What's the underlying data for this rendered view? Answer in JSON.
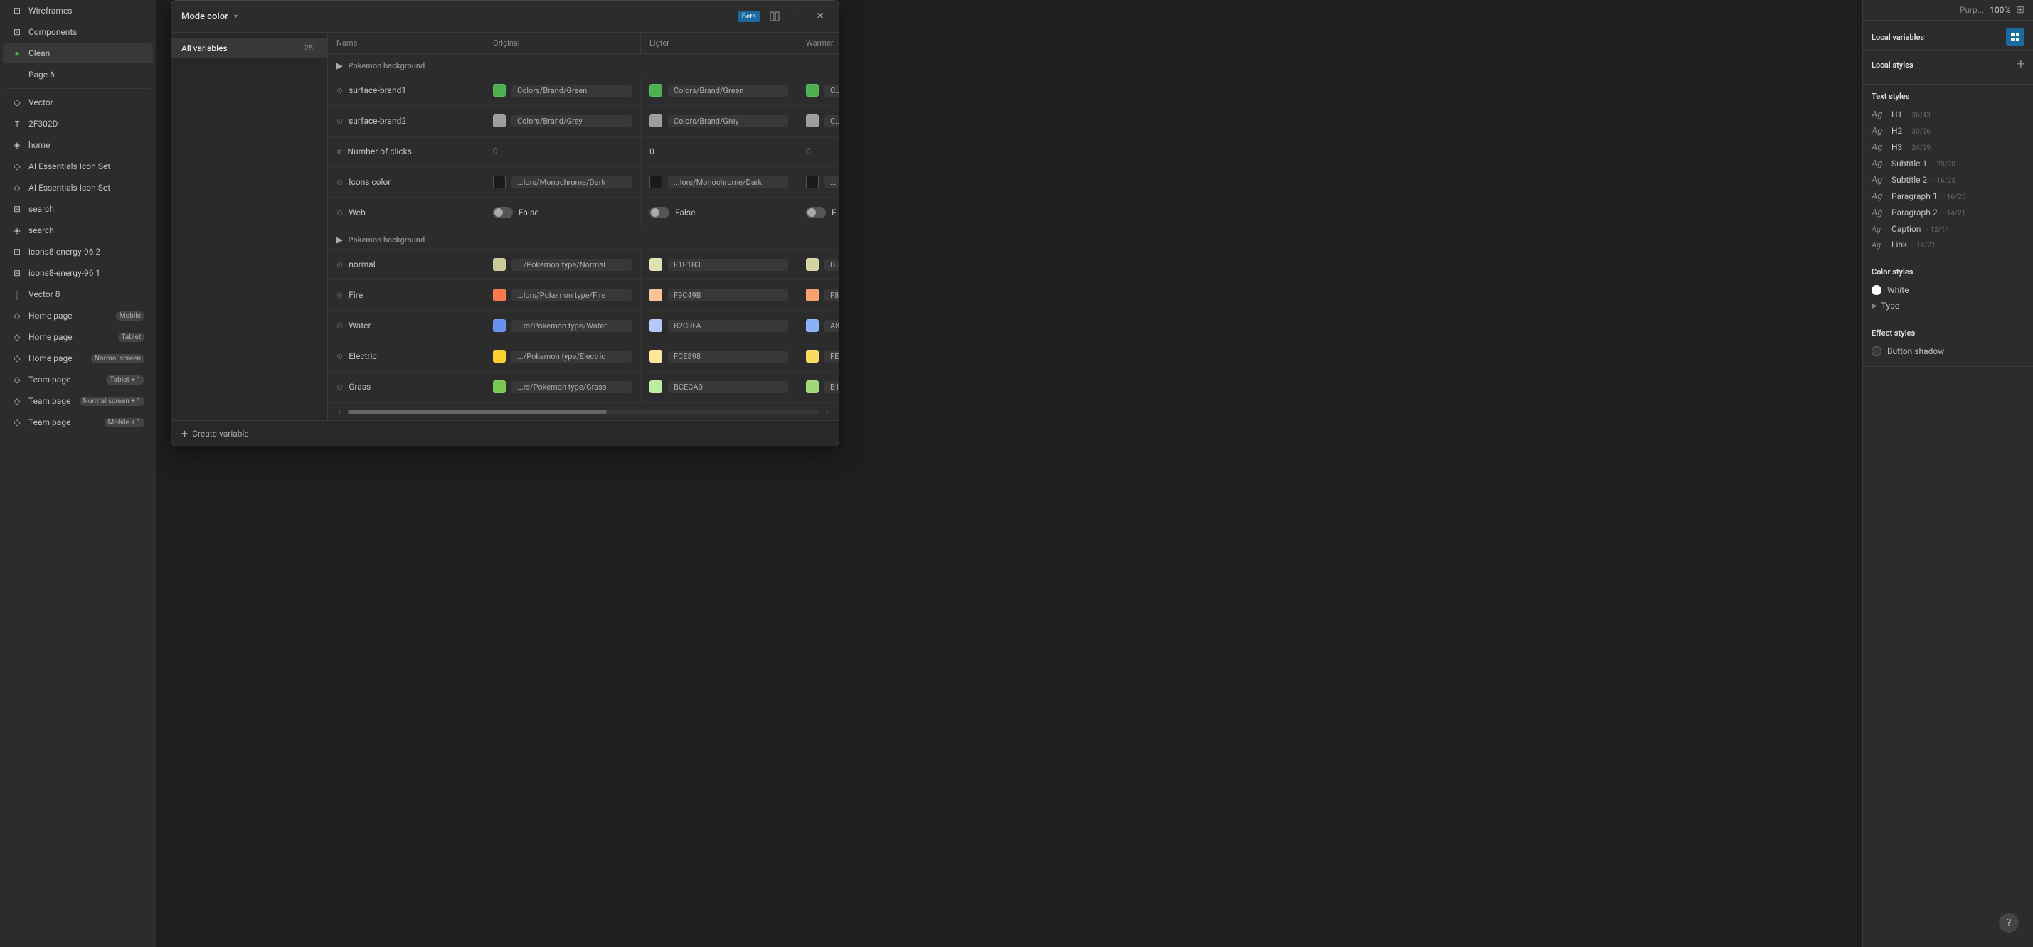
{
  "sidebar": {
    "items": [
      {
        "id": "wireframes",
        "label": "Wireframes",
        "icon": "⊡",
        "indent": 0
      },
      {
        "id": "components",
        "label": "Components",
        "icon": "⊡",
        "indent": 0
      },
      {
        "id": "clean",
        "label": "Clean",
        "icon": "●",
        "indent": 0,
        "active": true
      },
      {
        "id": "page6",
        "label": "Page 6",
        "indent": 0
      },
      {
        "id": "vector",
        "label": "Vector",
        "icon": "◇",
        "indent": 0
      },
      {
        "id": "2f302d",
        "label": "2F302D",
        "icon": "T",
        "indent": 0
      },
      {
        "id": "home",
        "label": "home",
        "icon": "◈",
        "indent": 0
      },
      {
        "id": "ai-ess-1",
        "label": "AI Essentials Icon Set",
        "icon": "◇",
        "indent": 0
      },
      {
        "id": "ai-ess-2",
        "label": "AI Essentials Icon Set",
        "icon": "◇",
        "indent": 0
      },
      {
        "id": "search1",
        "label": "search",
        "icon": "⊟",
        "indent": 0
      },
      {
        "id": "search2",
        "label": "search",
        "icon": "◈",
        "indent": 0
      },
      {
        "id": "icons8-2",
        "label": "icons8-energy-96 2",
        "icon": "⊟",
        "indent": 0
      },
      {
        "id": "icons8-1",
        "label": "icons8-energy-96 1",
        "icon": "⊟",
        "indent": 0
      },
      {
        "id": "vector8",
        "label": "Vector 8",
        "icon": "|",
        "indent": 0
      },
      {
        "id": "home-mobile",
        "label": "Home page",
        "badge": "Mobile",
        "badgeType": "mobile",
        "icon": "◇",
        "indent": 0
      },
      {
        "id": "home-tablet",
        "label": "Home page",
        "badge": "Tablet",
        "badgeType": "tablet",
        "icon": "◇",
        "indent": 0
      },
      {
        "id": "home-normal",
        "label": "Home page",
        "badge": "Normal screen",
        "badgeType": "normal",
        "icon": "◇",
        "indent": 0
      },
      {
        "id": "team-tablet",
        "label": "Team page",
        "badge": "Tablet + 1",
        "badgeType": "tablet",
        "icon": "◇",
        "indent": 0
      },
      {
        "id": "team-normal",
        "label": "Team page",
        "badge": "Normal screen + 1",
        "badgeType": "normal",
        "icon": "◇",
        "indent": 0
      },
      {
        "id": "team-mobile",
        "label": "Team page",
        "badge": "Mobile + 1",
        "badgeType": "mobile",
        "icon": "◇",
        "indent": 0
      }
    ]
  },
  "modal": {
    "title": "Mode color",
    "beta": "Beta",
    "nav": {
      "items": [
        {
          "label": "All variables",
          "count": "25",
          "active": true
        }
      ]
    },
    "table": {
      "columns": [
        "Name",
        "Original",
        "Ligter",
        "Warmer"
      ],
      "section1": {
        "label": "Pokemon background",
        "rows": [
          {
            "name": "surface-brand1",
            "icon": "⊙",
            "original_chip": "#4CAF50",
            "original_value": "Colors/Brand/Green",
            "ligter_chip": "#4CAF50",
            "ligter_value": "Colors/Brand/Green",
            "warmer_chip": "#4CAF50",
            "warmer_value": "C..."
          },
          {
            "name": "surface-brand2",
            "icon": "⊙",
            "original_chip": "#9E9E9E",
            "original_value": "Colors/Brand/Grey",
            "ligter_chip": "#9E9E9E",
            "ligter_value": "Colors/Brand/Grey",
            "warmer_chip": "#9E9E9E",
            "warmer_value": "C..."
          },
          {
            "name": "Number of clicks",
            "icon": "#",
            "original_value": "0",
            "ligter_value": "0",
            "warmer_value": "0",
            "is_number": true
          },
          {
            "name": "Icons color",
            "icon": "⊙",
            "original_chip": "#1a1a1a",
            "original_value": "...lors/Monochrome/Dark",
            "ligter_chip": "#1a1a1a",
            "ligter_value": "...lors/Monochrome/Dark",
            "warmer_chip": "#1a1a1a",
            "warmer_value": "..."
          },
          {
            "name": "Web",
            "icon": "⊙",
            "is_toggle": true,
            "original_toggle": false,
            "ligter_toggle": false,
            "warmer_toggle": false,
            "original_value": "False",
            "ligter_value": "False",
            "warmer_value": "F..."
          }
        ]
      },
      "section2": {
        "label": "Pokemon background",
        "rows": [
          {
            "name": "normal",
            "icon": "⊙",
            "original_chip": "#c8c89a",
            "original_value": ".../Pokemon type/Normal",
            "ligter_chip": "#E1E1B3",
            "ligter_value": "E1E1B3",
            "warmer_chip": "#d4d4a0",
            "warmer_value": "D..."
          },
          {
            "name": "Fire",
            "icon": "⊙",
            "original_chip": "#F9784B",
            "original_value": "...lors/Pokemon type/Fire",
            "ligter_chip": "#F9C49B",
            "ligter_value": "F9C49B",
            "warmer_chip": "#F9A070",
            "warmer_value": "F8..."
          },
          {
            "name": "Water",
            "icon": "⊙",
            "original_chip": "#6890F0",
            "original_value": "...rs/Pokemon type/Water",
            "ligter_chip": "#B2C9FA",
            "ligter_value": "B2C9FA",
            "warmer_chip": "#8ab0f8",
            "warmer_value": "A8..."
          },
          {
            "name": "Electric",
            "icon": "⊙",
            "original_chip": "#F8D030",
            "original_value": ".../Pokemon type/Electric",
            "ligter_chip": "#FCE898",
            "ligter_value": "FCE898",
            "warmer_chip": "#fada60",
            "warmer_value": "FE..."
          },
          {
            "name": "Grass",
            "icon": "⊙",
            "original_chip": "#78C850",
            "original_value": "...rs/Pokemon type/Grass",
            "ligter_chip": "#BCECA0",
            "ligter_value": "BCECA0",
            "warmer_chip": "#a0d878",
            "warmer_value": "B1..."
          }
        ]
      }
    },
    "footer": {
      "create_label": "Create variable"
    }
  },
  "right_panel": {
    "percent": "100%",
    "local_variables_label": "Local variables",
    "local_styles_label": "Local styles",
    "text_styles_label": "Text styles",
    "text_styles": [
      {
        "ag": "Ag",
        "label": "H1",
        "meta": "· 36/43"
      },
      {
        "ag": "Ag",
        "label": "H2",
        "meta": "· 30/36"
      },
      {
        "ag": "Ag",
        "label": "H3",
        "meta": "· 24/29"
      },
      {
        "ag": "Ag",
        "label": "Subtitle 1",
        "meta": "· 20/28"
      },
      {
        "ag": "Ag",
        "label": "Subtitle 2",
        "meta": "· 16/25"
      },
      {
        "ag": "Ag",
        "label": "Paragraph 1",
        "meta": "· 16/25"
      },
      {
        "ag": "Ag",
        "label": "Paragraph 2",
        "meta": "· 14/21"
      },
      {
        "ag": "Ag",
        "label": "Caption",
        "meta": "· 12/14"
      },
      {
        "ag": "Ag",
        "label": "Link",
        "meta": "· 14/21"
      }
    ],
    "color_styles_label": "Color styles",
    "color_styles": [
      {
        "label": "White",
        "color": "#ffffff"
      }
    ],
    "type_item": {
      "label": "Type"
    },
    "effect_styles_label": "Effect styles",
    "effect_styles": [
      {
        "label": "Button shadow"
      }
    ]
  }
}
